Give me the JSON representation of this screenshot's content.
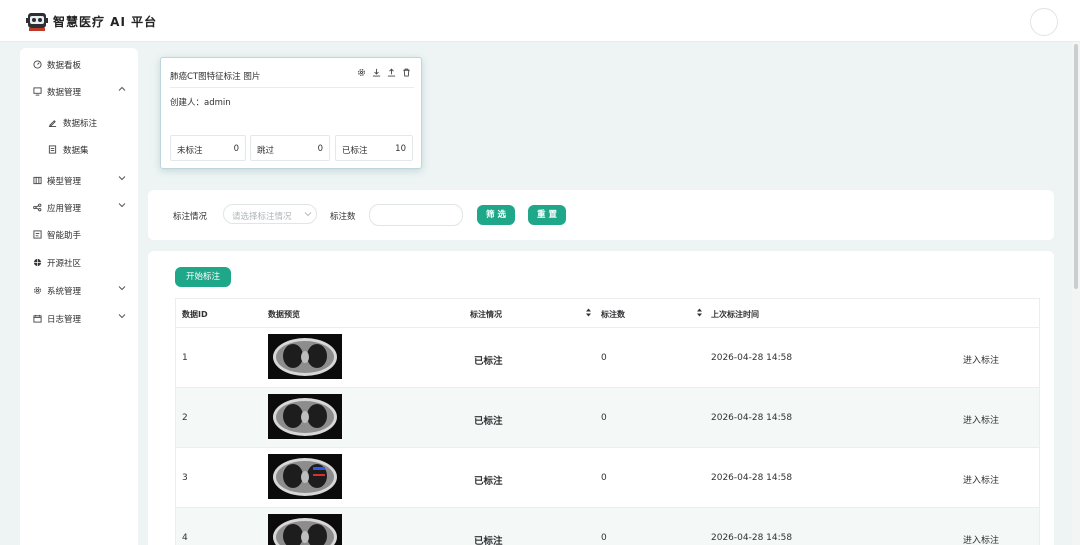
{
  "header": {
    "title": "智慧医疗 AI 平台"
  },
  "sidebar": {
    "items": [
      {
        "label": "数据看板",
        "icon": "dashboard-icon",
        "chevron": ""
      },
      {
        "label": "数据管理",
        "icon": "data-management-icon",
        "chevron": "up"
      },
      {
        "label": "数据标注",
        "icon": "annotate-pen-icon",
        "chevron": "",
        "sub": true
      },
      {
        "label": "数据集",
        "icon": "dataset-list-icon",
        "chevron": "",
        "sub": true
      },
      {
        "label": "模型管理",
        "icon": "model-icon",
        "chevron": "down"
      },
      {
        "label": "应用管理",
        "icon": "app-share-icon",
        "chevron": "down"
      },
      {
        "label": "智能助手",
        "icon": "assistant-icon",
        "chevron": ""
      },
      {
        "label": "开源社区",
        "icon": "globe-icon",
        "chevron": ""
      },
      {
        "label": "系统管理",
        "icon": "gear-icon",
        "chevron": "down"
      },
      {
        "label": "日志管理",
        "icon": "calendar-log-icon",
        "chevron": "down"
      }
    ]
  },
  "popover": {
    "title": "肺癌CT图特征标注  图片",
    "creator": "创建人：admin",
    "stats": [
      {
        "label": "未标注",
        "value": "0"
      },
      {
        "label": "跳过",
        "value": "0"
      },
      {
        "label": "已标注",
        "value": "10"
      }
    ]
  },
  "filter": {
    "status_label": "标注情况",
    "status_placeholder": "请选择标注情况",
    "count_label": "标注数",
    "count_value": "",
    "filter_button": "筛 选",
    "reset_button": "重 置"
  },
  "table": {
    "start_button": "开始标注",
    "columns": [
      "数据ID",
      "数据预览",
      "标注情况",
      "标注数",
      "上次标注时间"
    ],
    "rows": [
      {
        "id": "1",
        "status": "已标注",
        "count": "0",
        "time": "2026-04-28 14:58",
        "action": "进入标注"
      },
      {
        "id": "2",
        "status": "已标注",
        "count": "0",
        "time": "2026-04-28 14:58",
        "action": "进入标注"
      },
      {
        "id": "3",
        "status": "已标注",
        "count": "0",
        "time": "2026-04-28 14:58",
        "action": "进入标注"
      },
      {
        "id": "4",
        "status": "已标注",
        "count": "0",
        "time": "2026-04-28 14:58",
        "action": "进入标注"
      }
    ]
  },
  "colors": {
    "accent": "#1fa789",
    "background": "#eef4f4"
  }
}
